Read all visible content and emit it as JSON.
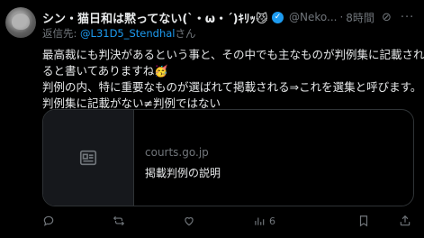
{
  "tweet": {
    "display_name": "シン・猫日和は黙ってない(`・ω・´)ｷﾘｯ😼",
    "handle": "@Neko...",
    "separator": "·",
    "time": "8時間",
    "reply_prefix": "返信先: ",
    "reply_to": "@L31D5_Stendhal",
    "reply_suffix": "さん",
    "body_lines": [
      "最高裁にも判決があるという事と、その中でも主なものが判例集に記載され",
      "ると書いてありますね🥳",
      "判例の内、特に重要なものが選ばれて掲載される⇒これを選集と呼びます。",
      "判例集に記載がない≠判例ではない"
    ],
    "link_card": {
      "domain": "courts.go.jp",
      "title": "掲載判例の説明"
    },
    "stats": {
      "views": "6"
    }
  },
  "colors": {
    "background": "#000000",
    "text": "#e7e9ea",
    "muted": "#71767b",
    "accent": "#1d9bf0",
    "border": "#2f3336"
  }
}
